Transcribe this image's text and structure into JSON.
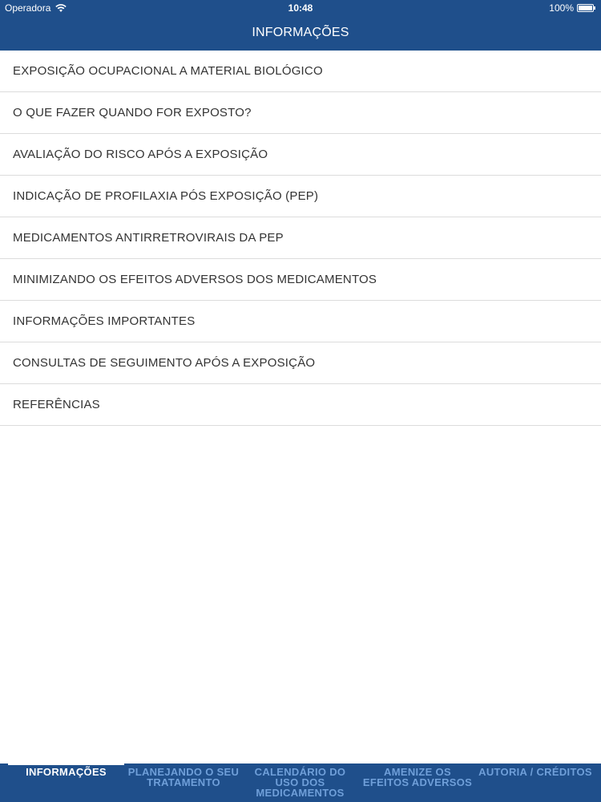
{
  "status_bar": {
    "carrier": "Operadora",
    "time": "10:48",
    "battery_text": "100%"
  },
  "nav": {
    "title": "INFORMAÇÕES"
  },
  "menu": {
    "items": [
      {
        "label": "EXPOSIÇÃO OCUPACIONAL A MATERIAL BIOLÓGICO"
      },
      {
        "label": "O QUE FAZER QUANDO FOR EXPOSTO?"
      },
      {
        "label": "AVALIAÇÃO DO RISCO APÓS A EXPOSIÇÃO"
      },
      {
        "label": "INDICAÇÃO DE PROFILAXIA PÓS EXPOSIÇÃO (PEP)"
      },
      {
        "label": "MEDICAMENTOS ANTIRRETROVIRAIS DA PEP"
      },
      {
        "label": "MINIMIZANDO OS EFEITOS ADVERSOS DOS MEDICAMENTOS"
      },
      {
        "label": "INFORMAÇÕES IMPORTANTES"
      },
      {
        "label": "CONSULTAS DE SEGUIMENTO APÓS A EXPOSIÇÃO"
      },
      {
        "label": "REFERÊNCIAS"
      }
    ]
  },
  "tabbar": {
    "tabs": [
      {
        "line1": "INFORMAÇÕES",
        "line2": "",
        "line3": ""
      },
      {
        "line1": "PLANEJANDO O SEU",
        "line2": "TRATAMENTO",
        "line3": ""
      },
      {
        "line1": "CALENDÁRIO DO",
        "line2": "USO DOS",
        "line3": "MEDICAMENTOS"
      },
      {
        "line1": "AMENIZE OS",
        "line2": "EFEITOS ADVERSOS",
        "line3": ""
      },
      {
        "line1": "AUTORIA / CRÉDITOS",
        "line2": "",
        "line3": ""
      }
    ],
    "active_index": 0
  },
  "colors": {
    "brand": "#1f4f8b",
    "tab_inactive": "#6f9fd9",
    "text": "#333333",
    "divider": "#dcdcdc"
  },
  "icons": {
    "wifi": "wifi-icon",
    "battery": "battery-icon"
  }
}
